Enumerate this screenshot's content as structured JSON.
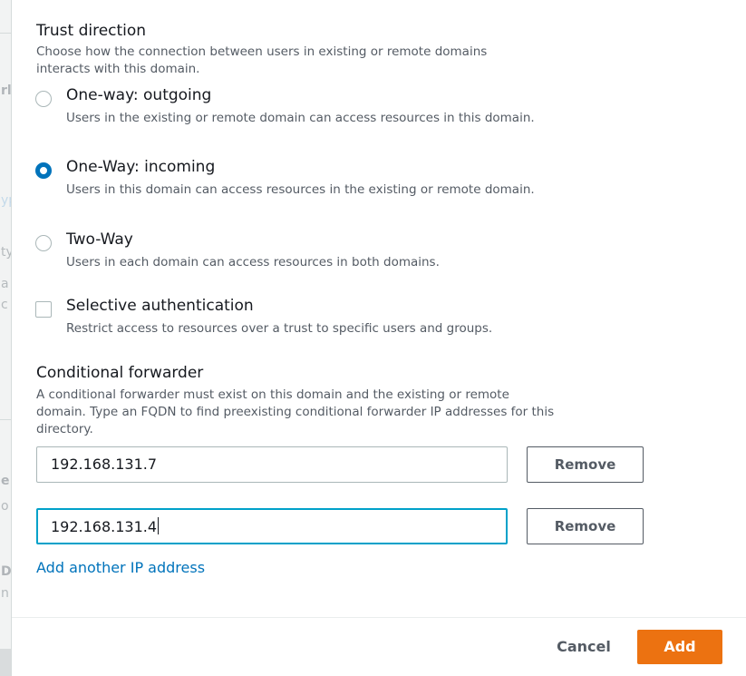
{
  "trust_direction": {
    "title": "Trust direction",
    "description": "Choose how the connection between users in existing or remote domains interacts with this domain.",
    "options": [
      {
        "label": "One-way: outgoing",
        "description": "Users in the existing or remote domain can access resources in this domain.",
        "selected": false
      },
      {
        "label": "One-Way: incoming",
        "description": "Users in this domain can access resources in the existing or remote domain.",
        "selected": true
      },
      {
        "label": "Two-Way",
        "description": "Users in each domain can access resources in both domains.",
        "selected": false
      }
    ]
  },
  "selective_auth": {
    "label": "Selective authentication",
    "description": "Restrict access to resources over a trust to specific users and groups.",
    "checked": false
  },
  "conditional_forwarder": {
    "title": "Conditional forwarder",
    "description": "A conditional forwarder must exist on this domain and the existing or remote domain. Type an FQDN to find preexisting conditional forwarder IP addresses for this directory.",
    "ip_addresses": [
      "192.168.131.7",
      "192.168.131.4"
    ],
    "remove_label": "Remove",
    "add_link": "Add another IP address"
  },
  "footer": {
    "cancel_label": "Cancel",
    "add_label": "Add"
  },
  "colors": {
    "accent": "#0073bb",
    "primary_button": "#ec7211",
    "focus_border": "#00a1c9"
  }
}
